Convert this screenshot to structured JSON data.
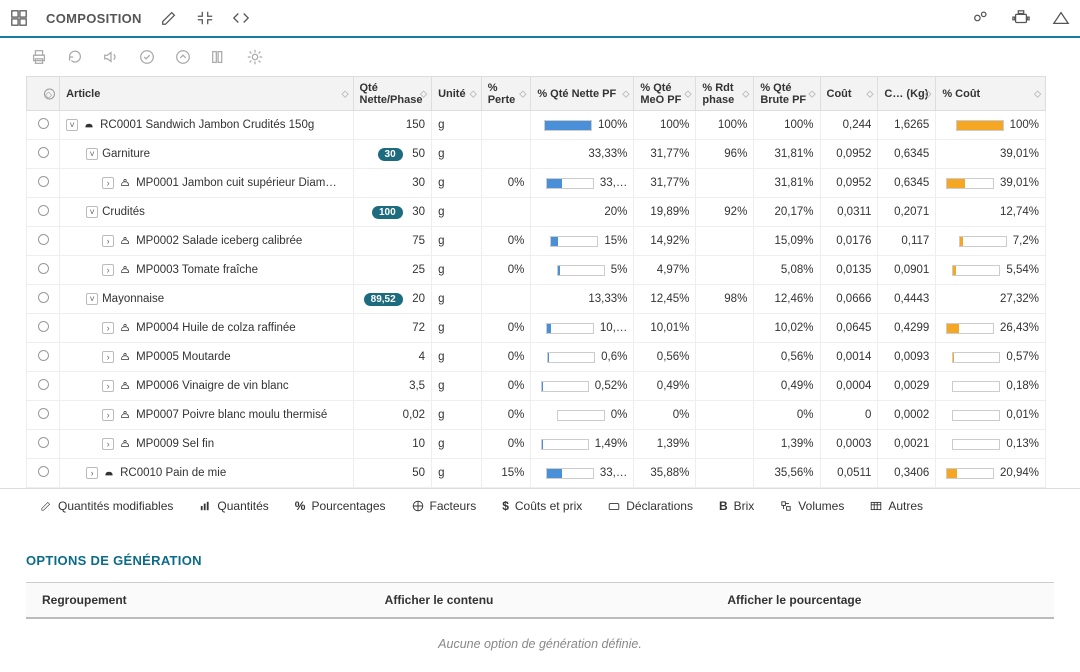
{
  "header": {
    "title": "COMPOSITION"
  },
  "columns": {
    "article": "Article",
    "qte_nette_phase": "Qté Nette/Phase",
    "unite": "Unité",
    "perte": "% Perte",
    "qte_nette_pf": "% Qté Nette PF",
    "qte_meo_pf": "% Qté MeO PF",
    "rdt_phase": "% Rdt phase",
    "qte_brute_pf": "% Qté Brute PF",
    "cout": "Coût",
    "cout_kg": "C… (Kg)",
    "pct_cout": "% Coût"
  },
  "rows": [
    {
      "lvl": 0,
      "expander": "v",
      "icon": "recipe",
      "label": "RC0001 Sandwich Jambon Crudités 150g",
      "qte": "150",
      "unit": "g",
      "perte": "",
      "nette_pf": "100%",
      "bar_n": 100,
      "meo": "100%",
      "rdt": "100%",
      "brute": "100%",
      "cout": "0,244",
      "ckg": "1,6265",
      "pct": "100%",
      "bar_c": 100
    },
    {
      "lvl": 1,
      "expander": "v",
      "icon": "",
      "label": "Garniture",
      "badge": "30",
      "qte": "50",
      "unit": "g",
      "perte": "",
      "nette_pf": "33,33%",
      "bar_n": null,
      "meo": "31,77%",
      "rdt": "96%",
      "brute": "31,81%",
      "cout": "0,0952",
      "ckg": "0,6345",
      "pct": "39,01%",
      "bar_c": null
    },
    {
      "lvl": 2,
      "expander": ">",
      "icon": "ingredient",
      "label": "MP0001 Jambon cuit supérieur Diam…",
      "qte": "30",
      "unit": "g",
      "perte": "0%",
      "nette_pf": "33,…",
      "bar_n": 33,
      "meo": "31,77%",
      "rdt": "",
      "brute": "31,81%",
      "cout": "0,0952",
      "ckg": "0,6345",
      "pct": "39,01%",
      "bar_c": 39
    },
    {
      "lvl": 1,
      "expander": "v",
      "icon": "",
      "label": "Crudités",
      "badge": "100",
      "qte": "30",
      "unit": "g",
      "perte": "",
      "nette_pf": "20%",
      "bar_n": null,
      "meo": "19,89%",
      "rdt": "92%",
      "brute": "20,17%",
      "cout": "0,0311",
      "ckg": "0,2071",
      "pct": "12,74%",
      "bar_c": null
    },
    {
      "lvl": 2,
      "expander": ">",
      "icon": "ingredient",
      "label": "MP0002 Salade iceberg calibrée",
      "qte": "75",
      "unit": "g",
      "perte": "0%",
      "nette_pf": "15%",
      "bar_n": 15,
      "meo": "14,92%",
      "rdt": "",
      "brute": "15,09%",
      "cout": "0,0176",
      "ckg": "0,117",
      "pct": "7,2%",
      "bar_c": 7
    },
    {
      "lvl": 2,
      "expander": ">",
      "icon": "ingredient",
      "label": "MP0003 Tomate fraîche",
      "qte": "25",
      "unit": "g",
      "perte": "0%",
      "nette_pf": "5%",
      "bar_n": 5,
      "meo": "4,97%",
      "rdt": "",
      "brute": "5,08%",
      "cout": "0,0135",
      "ckg": "0,0901",
      "pct": "5,54%",
      "bar_c": 6
    },
    {
      "lvl": 1,
      "expander": "v",
      "icon": "",
      "label": "Mayonnaise",
      "badge": "89,52",
      "qte": "20",
      "unit": "g",
      "perte": "",
      "nette_pf": "13,33%",
      "bar_n": null,
      "meo": "12,45%",
      "rdt": "98%",
      "brute": "12,46%",
      "cout": "0,0666",
      "ckg": "0,4443",
      "pct": "27,32%",
      "bar_c": null
    },
    {
      "lvl": 2,
      "expander": ">",
      "icon": "ingredient",
      "label": "MP0004 Huile de colza raffinée",
      "qte": "72",
      "unit": "g",
      "perte": "0%",
      "nette_pf": "10,…",
      "bar_n": 10,
      "meo": "10,01%",
      "rdt": "",
      "brute": "10,02%",
      "cout": "0,0645",
      "ckg": "0,4299",
      "pct": "26,43%",
      "bar_c": 26
    },
    {
      "lvl": 2,
      "expander": ">",
      "icon": "ingredient",
      "label": "MP0005 Moutarde",
      "qte": "4",
      "unit": "g",
      "perte": "0%",
      "nette_pf": "0,6%",
      "bar_n": 1,
      "meo": "0,56%",
      "rdt": "",
      "brute": "0,56%",
      "cout": "0,0014",
      "ckg": "0,0093",
      "pct": "0,57%",
      "bar_c": 1
    },
    {
      "lvl": 2,
      "expander": ">",
      "icon": "ingredient",
      "label": "MP0006 Vinaigre de vin blanc",
      "qte": "3,5",
      "unit": "g",
      "perte": "0%",
      "nette_pf": "0,52%",
      "bar_n": 1,
      "meo": "0,49%",
      "rdt": "",
      "brute": "0,49%",
      "cout": "0,0004",
      "ckg": "0,0029",
      "pct": "0,18%",
      "bar_c": 0
    },
    {
      "lvl": 2,
      "expander": ">",
      "icon": "ingredient",
      "label": "MP0007 Poivre blanc moulu thermisé",
      "qte": "0,02",
      "unit": "g",
      "perte": "0%",
      "nette_pf": "0%",
      "bar_n": 0,
      "meo": "0%",
      "rdt": "",
      "brute": "0%",
      "cout": "0",
      "ckg": "0,0002",
      "pct": "0,01%",
      "bar_c": 0
    },
    {
      "lvl": 2,
      "expander": ">",
      "icon": "ingredient",
      "label": "MP0009 Sel fin",
      "qte": "10",
      "unit": "g",
      "perte": "0%",
      "nette_pf": "1,49%",
      "bar_n": 2,
      "meo": "1,39%",
      "rdt": "",
      "brute": "1,39%",
      "cout": "0,0003",
      "ckg": "0,0021",
      "pct": "0,13%",
      "bar_c": 0
    },
    {
      "lvl": 1,
      "expander": ">",
      "icon": "recipe",
      "label": "RC0010 Pain de mie",
      "qte": "50",
      "unit": "g",
      "perte": "15%",
      "nette_pf": "33,…",
      "bar_n": 33,
      "meo": "35,88%",
      "rdt": "",
      "brute": "35,56%",
      "cout": "0,0511",
      "ckg": "0,3406",
      "pct": "20,94%",
      "bar_c": 21
    }
  ],
  "footer_tabs": {
    "quantites_modif": "Quantités modifiables",
    "quantites": "Quantités",
    "pourcentages": "Pourcentages",
    "facteurs": "Facteurs",
    "couts": "Coûts et prix",
    "declarations": "Déclarations",
    "brix": "Brix",
    "volumes": "Volumes",
    "autres": "Autres"
  },
  "generation": {
    "title": "OPTIONS DE GÉNÉRATION",
    "col1": "Regroupement",
    "col2": "Afficher le contenu",
    "col3": "Afficher le pourcentage",
    "empty": "Aucune option de génération définie."
  },
  "icons": {
    "b_label": "B"
  }
}
